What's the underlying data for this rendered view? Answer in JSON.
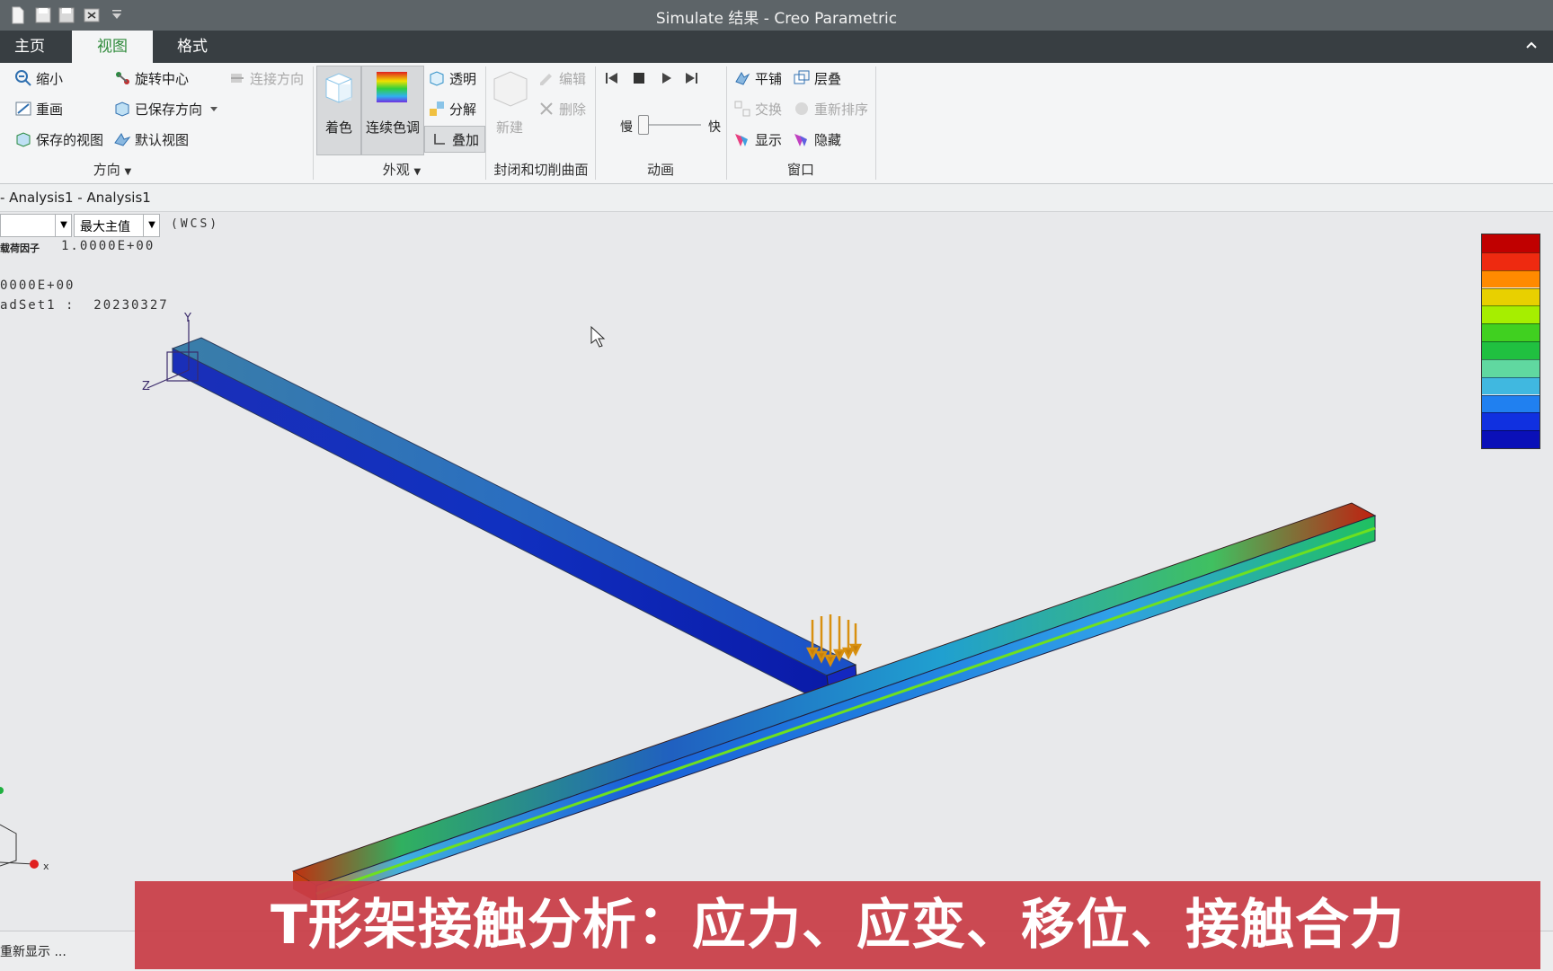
{
  "window": {
    "title": "Simulate 结果 - Creo Parametric"
  },
  "quick_access": [
    "new-icon",
    "save-icon",
    "save-all-icon",
    "close-window-icon",
    "customize-dropdown-icon"
  ],
  "tabs": [
    {
      "label": "主页",
      "active": false
    },
    {
      "label": "视图",
      "active": true
    },
    {
      "label": "格式",
      "active": false
    }
  ],
  "ribbon": {
    "orientation": {
      "zoom_out": "缩小",
      "spin_center": "旋转中心",
      "connect_orientation": "连接方向",
      "repaint": "重画",
      "saved_orientations": "已保存方向",
      "saved_views": "保存的视图",
      "default_view": "默认视图",
      "group_label": "方向"
    },
    "appearance": {
      "shading": "着色",
      "continuous_tone": "连续色调",
      "transparent": "透明",
      "explode": "分解",
      "overlay": "叠加",
      "group_label": "外观"
    },
    "capping": {
      "new": "新建",
      "edit": "编辑",
      "delete": "删除",
      "group_label": "封闭和切削曲面"
    },
    "animation": {
      "slow": "慢",
      "fast": "快",
      "group_label": "动画"
    },
    "window": {
      "tile": "平铺",
      "cascade": "层叠",
      "swap": "交换",
      "reorder": "重新排序",
      "show": "显示",
      "hide": "隐藏",
      "group_label": "窗口"
    }
  },
  "analysis": {
    "title": "- Analysis1 - Analysis1",
    "component_select": "最大主值",
    "coord_system": "(WCS)",
    "load_factor_label": "载荷因子",
    "load_factor_value": "1.0000E+00",
    "line3": "0000E+00",
    "loadset_line": "adSet1 :  20230327"
  },
  "triad_labels": {
    "y": "Y",
    "z": "Z",
    "x": "X"
  },
  "status": {
    "text": "重新显示 ..."
  },
  "banner": {
    "text": "T形架接触分析：应力、应变、移位、接触合力"
  },
  "colors": {
    "legend": [
      "#c00000",
      "#ee2a10",
      "#ff8a00",
      "#e8d000",
      "#a6ee00",
      "#40d020",
      "#20c040",
      "#60d8a0",
      "#40b8e0",
      "#2080f0",
      "#1030e0",
      "#0a10b8"
    ]
  }
}
